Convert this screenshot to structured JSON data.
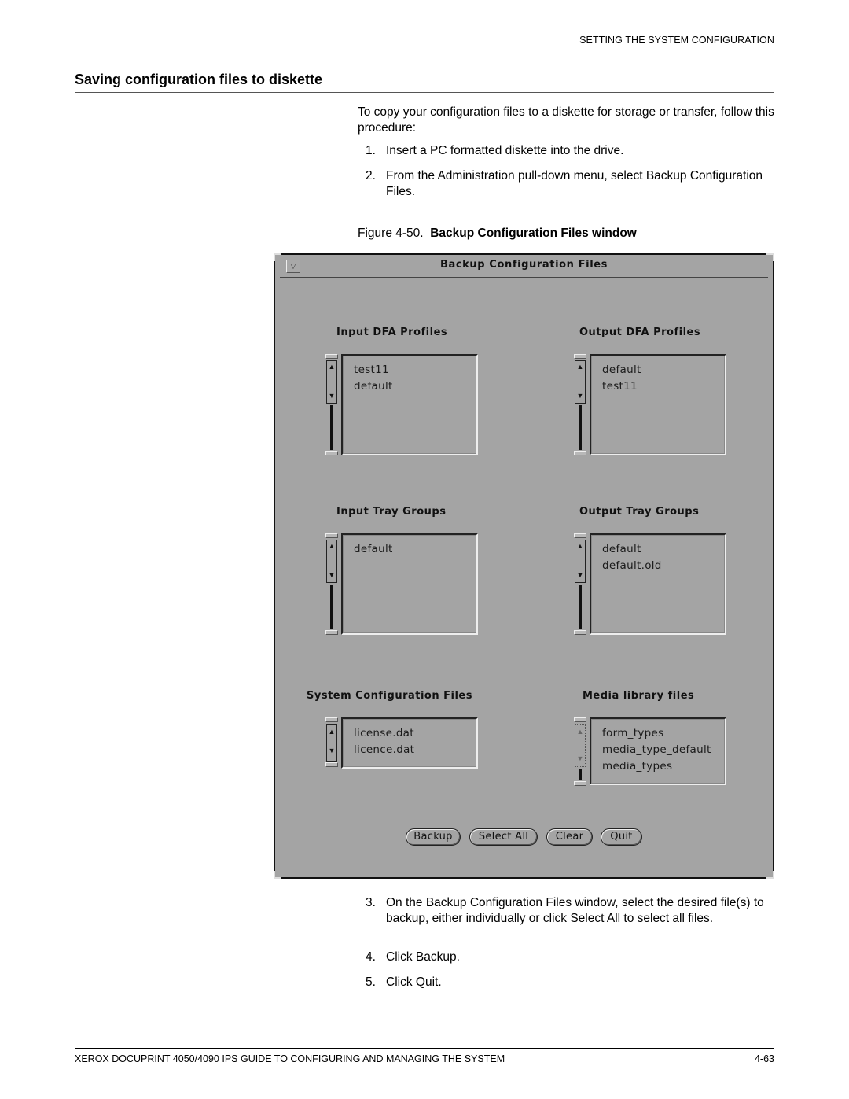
{
  "header": {
    "running_head": "SETTING THE SYSTEM CONFIGURATION",
    "section_title": "Saving configuration files to diskette"
  },
  "intro": "To copy your configuration files to a diskette for storage or transfer, follow this procedure:",
  "steps_before": [
    {
      "num": "1.",
      "text": "Insert a PC formatted diskette into the drive."
    },
    {
      "num": "2.",
      "text": "From the Administration pull-down menu, select Backup Configuration Files."
    }
  ],
  "figure": {
    "label": "Figure 4-50.",
    "title": "Backup Configuration Files window"
  },
  "window": {
    "title": "Backup Configuration Files",
    "menu_glyph": "▽",
    "groups": [
      {
        "label": "Input DFA Profiles",
        "items": [
          "test11",
          "default"
        ]
      },
      {
        "label": "Output DFA Profiles",
        "items": [
          "default",
          "test11"
        ]
      },
      {
        "label": "Input Tray Groups",
        "items": [
          "default"
        ]
      },
      {
        "label": "Output Tray Groups",
        "items": [
          "default",
          "default.old"
        ]
      },
      {
        "label": "System Configuration Files",
        "items": [
          "license.dat",
          "licence.dat"
        ]
      },
      {
        "label": "Media library files",
        "items": [
          "form_types",
          "media_type_default",
          "media_types"
        ]
      }
    ],
    "buttons": {
      "backup": "Backup",
      "select_all": "Select All",
      "clear": "Clear",
      "quit": "Quit"
    },
    "scroll_up_glyph": "▲",
    "scroll_down_glyph": "▼"
  },
  "steps_after": [
    {
      "num": "3.",
      "text": "On the Backup Configuration Files window, select the desired file(s) to backup, either individually or click Select All to select all files."
    },
    {
      "num": "4.",
      "text": "Click Backup."
    },
    {
      "num": "5.",
      "text": "Click Quit."
    }
  ],
  "footer": {
    "left": "XEROX DOCUPRINT 4050/4090 IPS GUIDE TO CONFIGURING AND MANAGING THE SYSTEM",
    "right": "4-63"
  }
}
